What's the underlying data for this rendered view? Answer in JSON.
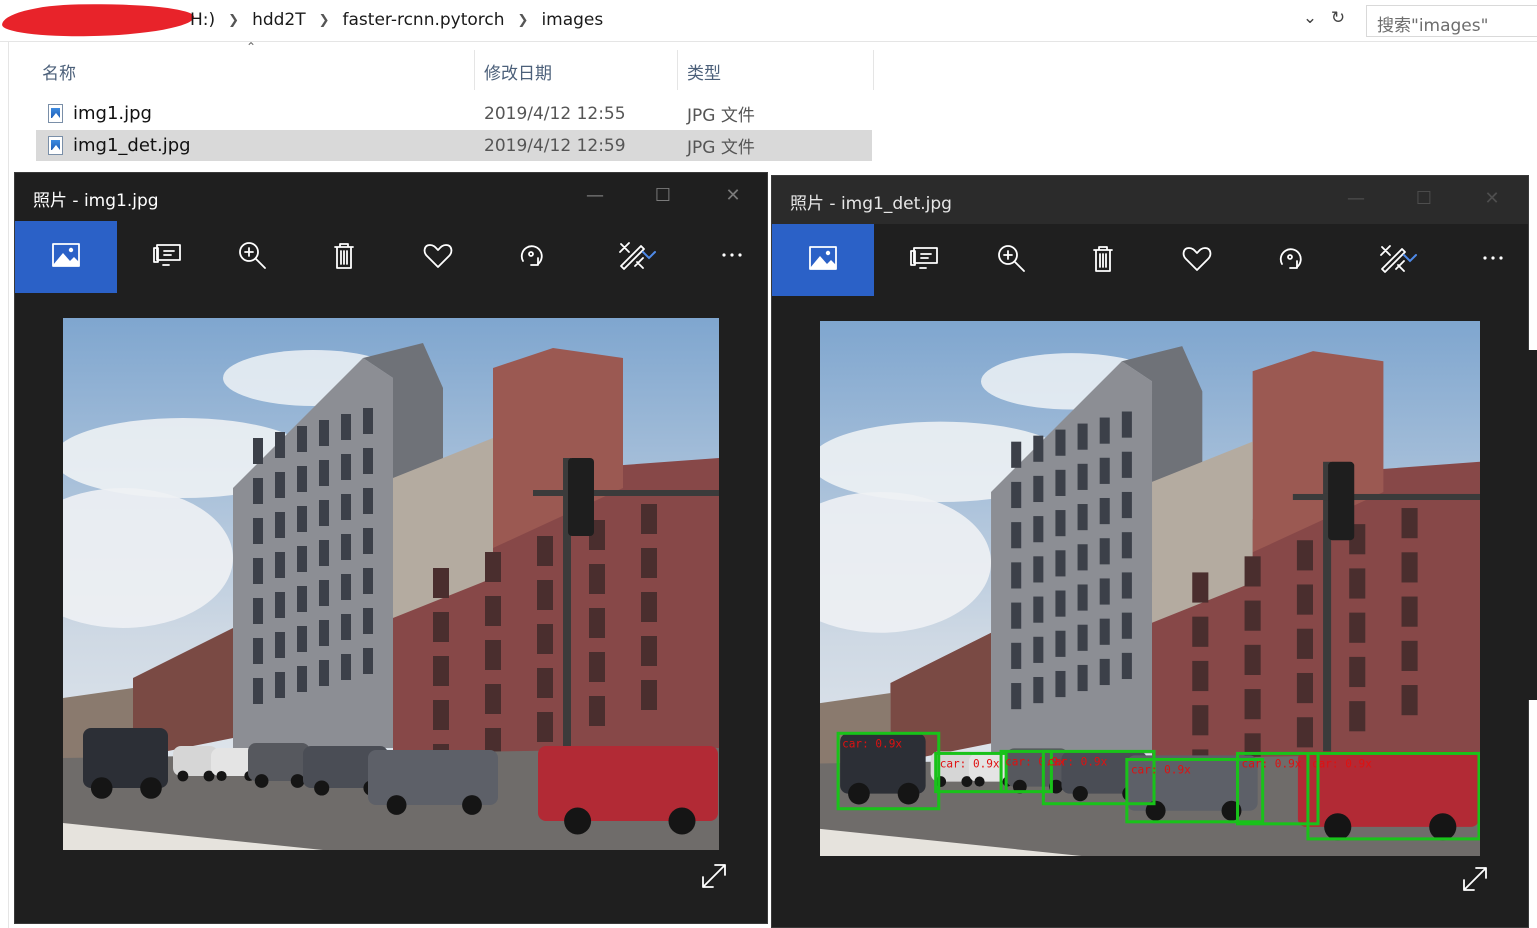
{
  "explorer": {
    "breadcrumb": [
      "H:)",
      "hdd2T",
      "faster-rcnn.pytorch",
      "images"
    ],
    "search_placeholder": "搜索\"images\"",
    "columns": {
      "name": "名称",
      "date": "修改日期",
      "type": "类型"
    },
    "files": [
      {
        "name": "img1.jpg",
        "date": "2019/4/12 12:55",
        "type": "JPG 文件",
        "selected": false
      },
      {
        "name": "img1_det.jpg",
        "date": "2019/4/12 12:59",
        "type": "JPG 文件",
        "selected": true
      }
    ]
  },
  "photos_windows": [
    {
      "title": "照片 - img1.jpg"
    },
    {
      "title": "照片 - img1_det.jpg"
    }
  ],
  "toolbar_icons": [
    "image-icon",
    "slideshow-icon",
    "zoom-in-icon",
    "delete-icon",
    "favorite-icon",
    "rotate-icon",
    "edit-icon",
    "chevron-down-icon",
    "more-icon"
  ],
  "detections": [
    {
      "label": "car: 0.9x"
    },
    {
      "label": "car: 0.9x"
    },
    {
      "label": "car: 0.9x"
    },
    {
      "label": "car: 0.9x"
    },
    {
      "label": "car: 0.9x"
    },
    {
      "label": "car: 0.9x"
    },
    {
      "label": "car: 0.9x"
    }
  ],
  "colors": {
    "accent": "#2b61c7",
    "photos_bg": "#1f1f1f",
    "box": "#19c21a",
    "box_label": "#e01010",
    "selection": "#d9d9d9",
    "redaction": "#e8232a"
  }
}
